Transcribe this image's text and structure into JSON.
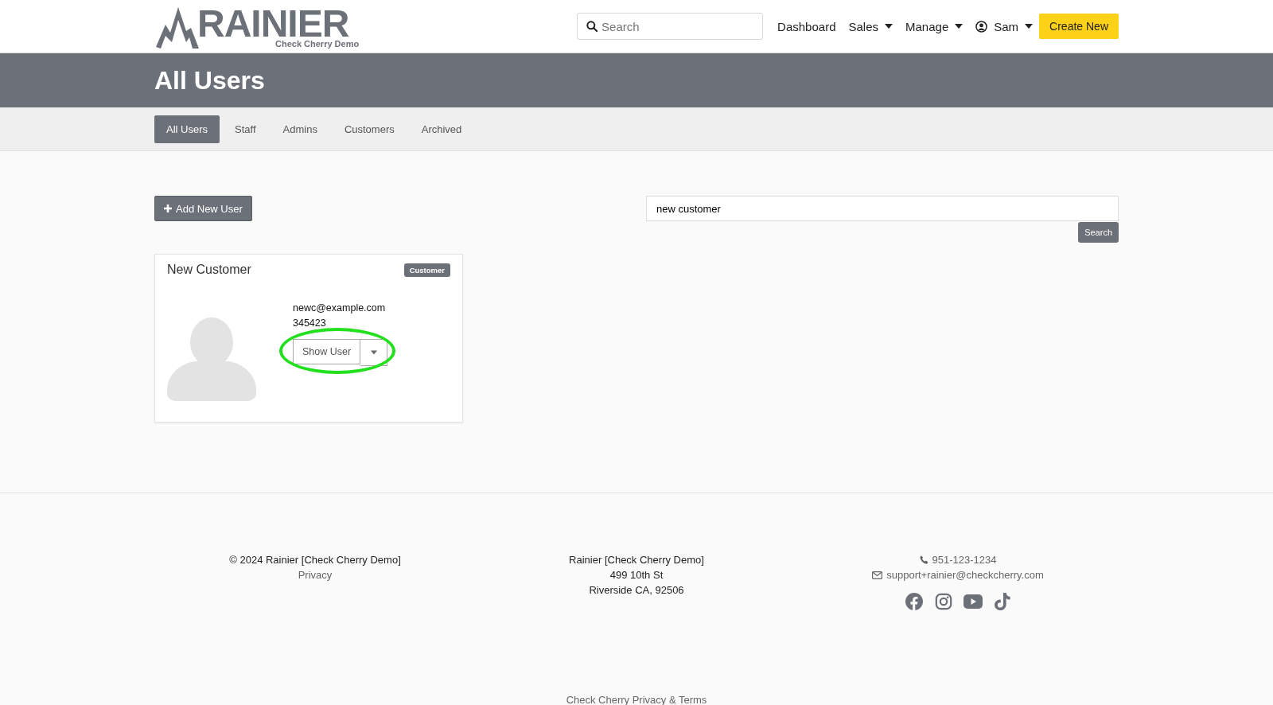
{
  "header": {
    "logo_text": "RAINIER",
    "logo_subtext": "Check Cherry Demo",
    "search": {
      "placeholder": "Search"
    },
    "nav": [
      {
        "label": "Dashboard",
        "dropdown": false
      },
      {
        "label": "Sales",
        "dropdown": true
      },
      {
        "label": "Manage",
        "dropdown": true
      },
      {
        "label": "Sam",
        "dropdown": true,
        "kind": "user"
      }
    ],
    "create_button": "Create New"
  },
  "page_title": "All Users",
  "tabs": [
    {
      "label": "All Users",
      "selected": true
    },
    {
      "label": "Staff",
      "selected": false
    },
    {
      "label": "Admins",
      "selected": false
    },
    {
      "label": "Customers",
      "selected": false
    },
    {
      "label": "Archived",
      "selected": false
    }
  ],
  "add_button": "Add New User",
  "user_search": {
    "value": "new customer",
    "button": "Search"
  },
  "users": [
    {
      "name": "New Customer",
      "role": "Customer",
      "email": "newc@example.com",
      "phone": "345423",
      "action": "Show User",
      "highlighted": true
    }
  ],
  "footer": {
    "copyright": "© 2024 Rainier [Check Cherry Demo]",
    "privacy": "Privacy",
    "address": [
      "Rainier [Check Cherry Demo]",
      "499 10th St",
      "Riverside CA, 92506"
    ],
    "phone": "951-123-1234",
    "email": "support+rainier@checkcherry.com",
    "social": [
      {
        "kind": "facebook"
      },
      {
        "kind": "instagram"
      },
      {
        "kind": "youtube"
      },
      {
        "kind": "tiktok"
      }
    ],
    "bottom_link": "Check Cherry Privacy & Terms"
  }
}
